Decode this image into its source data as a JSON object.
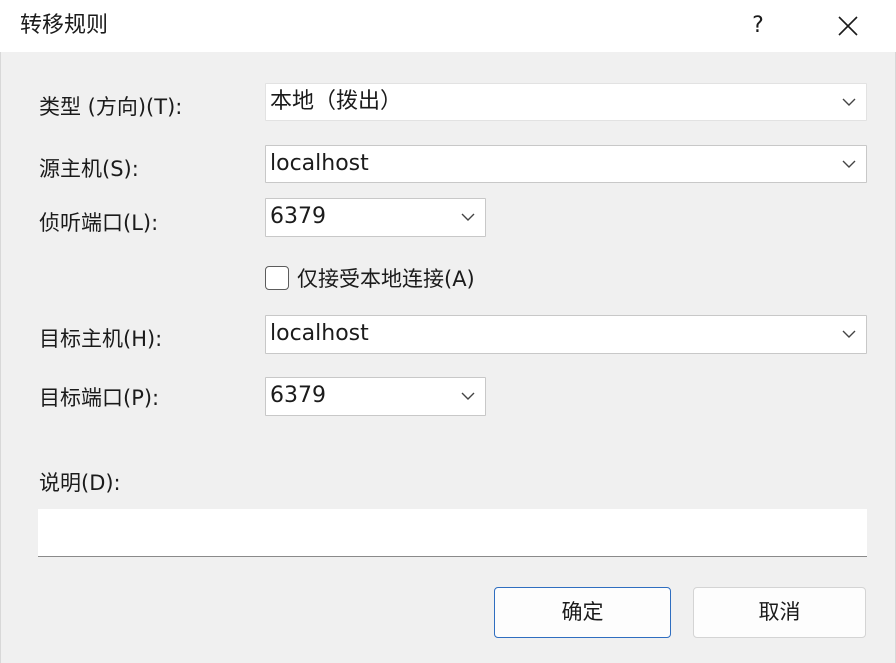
{
  "dialog": {
    "title": "转移规则",
    "help_label": "?"
  },
  "form": {
    "type_label": "类型 (方向)(T):",
    "type_value": "本地（拨出）",
    "source_host_label": "源主机(S):",
    "source_host_value": "localhost",
    "listen_port_label": "侦听端口(L):",
    "listen_port_value": "6379",
    "local_only_label": "仅接受本地连接(A)",
    "local_only_checked": false,
    "target_host_label": "目标主机(H):",
    "target_host_value": "localhost",
    "target_port_label": "目标端口(P):",
    "target_port_value": "6379",
    "description_label": "说明(D):",
    "description_value": ""
  },
  "buttons": {
    "ok": "确定",
    "cancel": "取消"
  },
  "colors": {
    "background": "#f0f0f0",
    "ok_border": "#2f6ec0"
  }
}
